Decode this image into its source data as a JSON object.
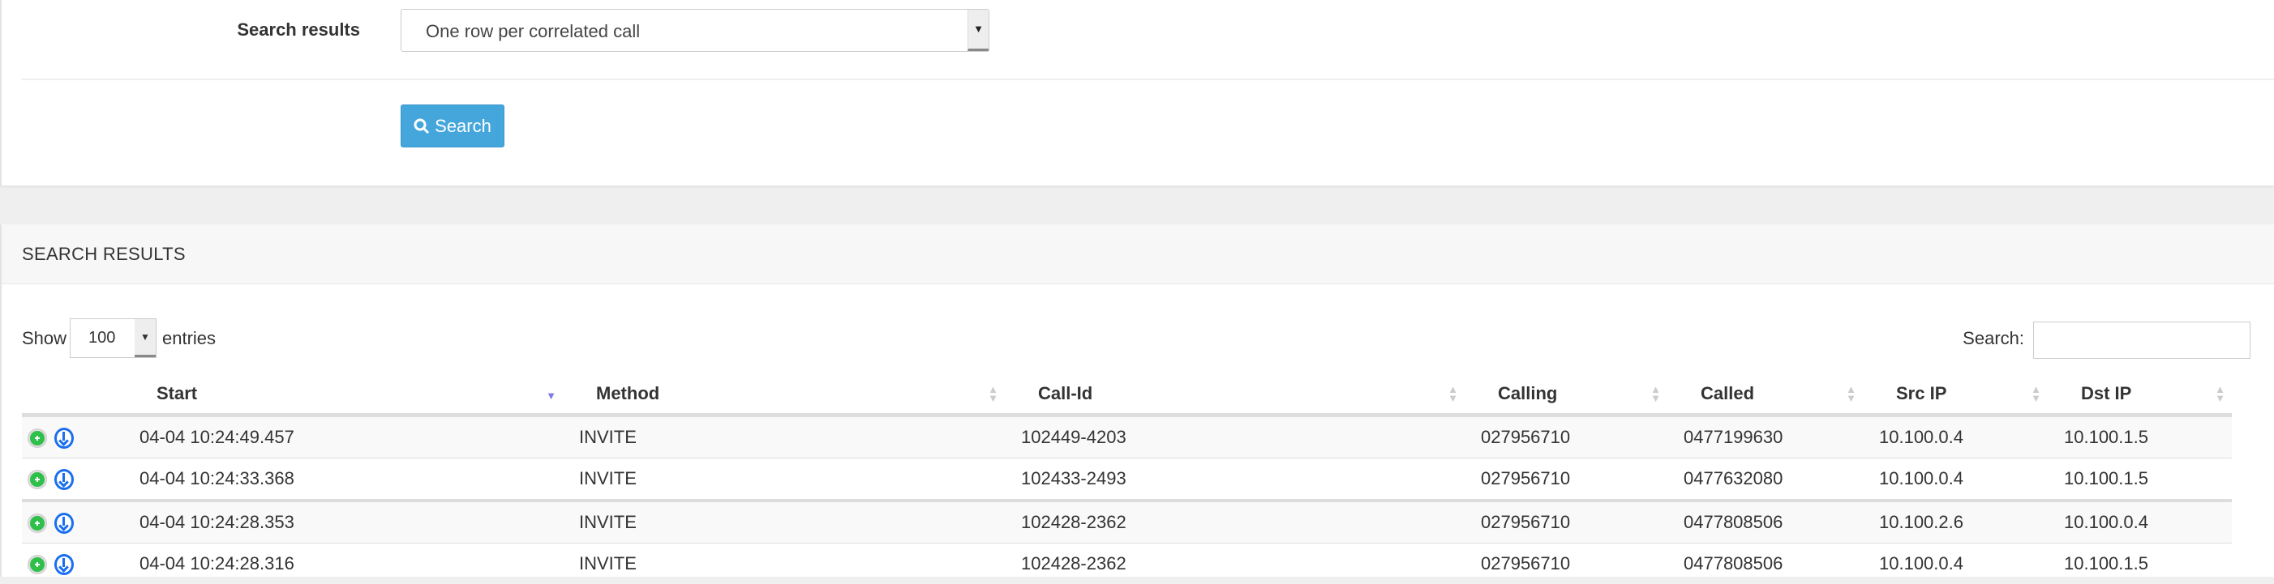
{
  "form": {
    "search_results_label": "Search results",
    "search_results_value": "One row per correlated call",
    "search_button": "Search",
    "accent": "#45a6dc"
  },
  "results": {
    "title": "SEARCH RESULTS",
    "show_label": "Show",
    "page_length": "100",
    "entries_label": "entries",
    "search_label": "Search:",
    "search_value": "",
    "sorted_column": "Start",
    "columns": [
      "Start",
      "Method",
      "Call-Id",
      "Calling",
      "Called",
      "Src IP",
      "Dst IP"
    ],
    "rows": [
      [
        "04-04 10:24:49.457",
        "INVITE",
        "102449-4203",
        "027956710",
        "0477199630",
        "10.100.0.4",
        "10.100.1.5"
      ],
      [
        "04-04 10:24:33.368",
        "INVITE",
        "102433-2493",
        "027956710",
        "0477632080",
        "10.100.0.4",
        "10.100.1.5"
      ],
      [
        "04-04 10:24:28.353",
        "INVITE",
        "102428-2362",
        "027956710",
        "0477808506",
        "10.100.2.6",
        "10.100.0.4"
      ],
      [
        "04-04 10:24:28.316",
        "INVITE",
        "102428-2362",
        "027956710",
        "0477808506",
        "10.100.0.4",
        "10.100.1.5"
      ]
    ],
    "row_icons": [
      "plus-circle-icon",
      "download-circle-icon"
    ]
  }
}
